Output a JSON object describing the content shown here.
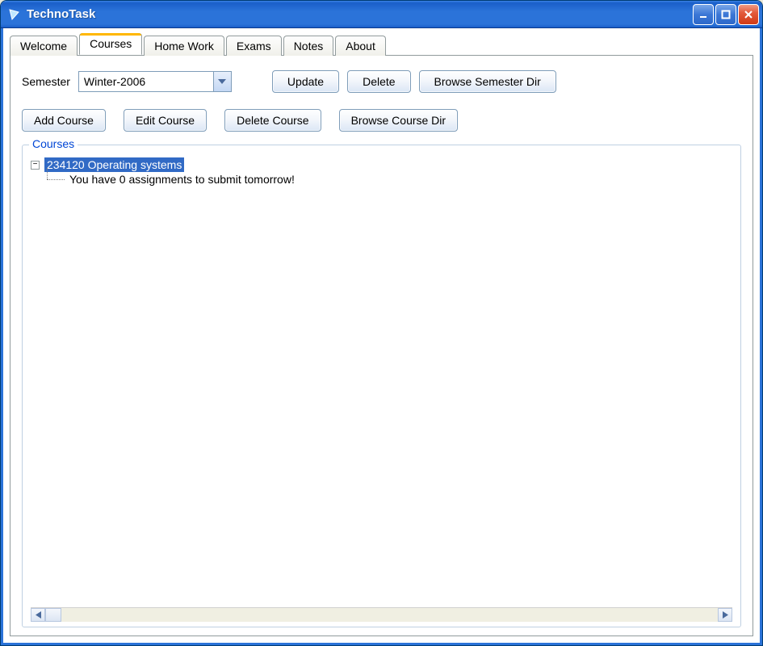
{
  "window": {
    "title": "TechnoTask"
  },
  "tabs": [
    {
      "label": "Welcome"
    },
    {
      "label": "Courses"
    },
    {
      "label": "Home Work"
    },
    {
      "label": "Exams"
    },
    {
      "label": "Notes"
    },
    {
      "label": "About"
    }
  ],
  "active_tab_index": 1,
  "semester": {
    "label": "Semester",
    "value": "Winter-2006"
  },
  "buttons": {
    "update": "Update",
    "delete": "Delete",
    "browse_semester_dir": "Browse Semester Dir",
    "add_course": "Add Course",
    "edit_course": "Edit Course",
    "delete_course": "Delete Course",
    "browse_course_dir": "Browse Course Dir"
  },
  "groupbox": {
    "label": "Courses"
  },
  "tree": {
    "nodes": [
      {
        "expanded": true,
        "label": "234120 Operating systems",
        "selected": true,
        "children": [
          {
            "label": "You have 0 assignments to submit tomorrow!"
          }
        ]
      }
    ]
  },
  "icons": {
    "app": "app-icon",
    "minimize": "minimize-icon",
    "maximize": "maximize-icon",
    "close": "close-icon",
    "chevron_down": "chevron-down-icon",
    "tree_collapse": "−",
    "arrow_left": "◀",
    "arrow_right": "▶"
  }
}
